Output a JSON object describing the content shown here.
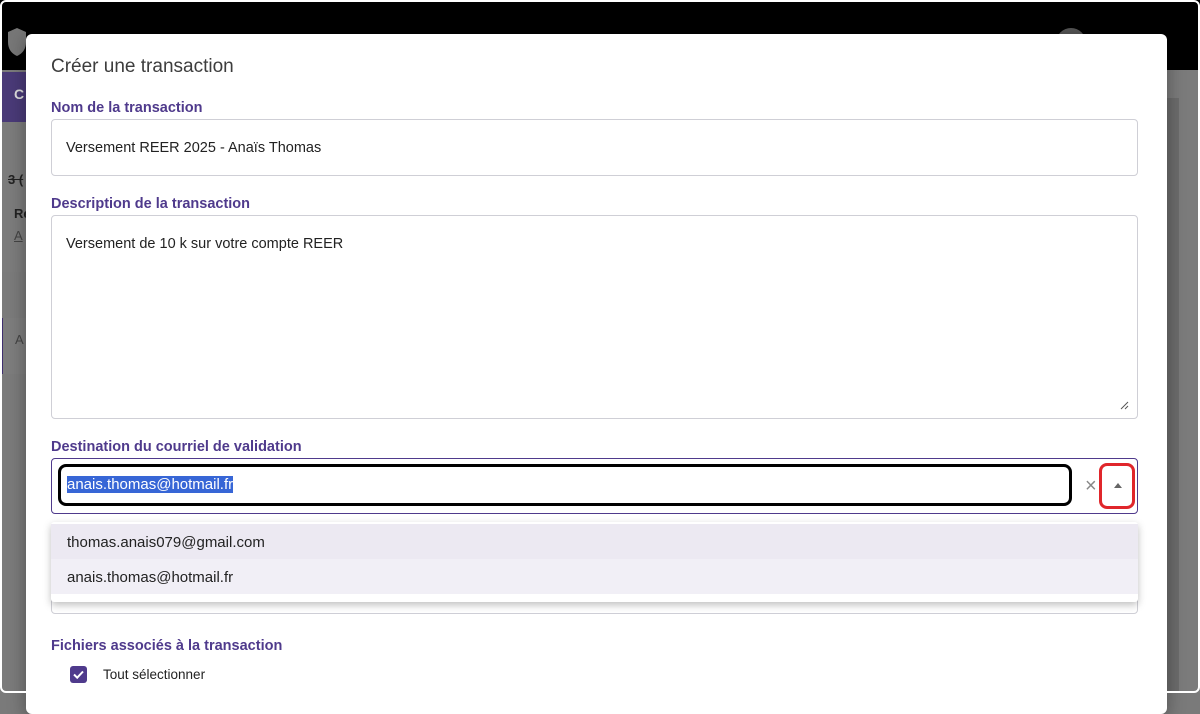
{
  "background": {
    "fragments": [
      "C",
      "3 (",
      "Re",
      "A",
      "A"
    ]
  },
  "modal": {
    "title": "Créer une transaction",
    "name_field": {
      "label": "Nom de la transaction",
      "value": "Versement REER 2025 - Anaïs Thomas"
    },
    "description_field": {
      "label": "Description de la transaction",
      "value": "Versement de 10 k sur votre compte REER"
    },
    "email_field": {
      "label": "Destination du courriel de validation",
      "value": "anais.thomas@hotmail.fr",
      "clear_icon": "×",
      "options": [
        "thomas.anais079@gmail.com",
        "anais.thomas@hotmail.fr"
      ]
    },
    "files": {
      "label": "Fichiers associés à la transaction",
      "select_all_label": "Tout sélectionner",
      "select_all_checked": true
    }
  },
  "colors": {
    "accent": "#4f3a8c",
    "highlight": "#e0262b",
    "selection": "#3766d6"
  }
}
